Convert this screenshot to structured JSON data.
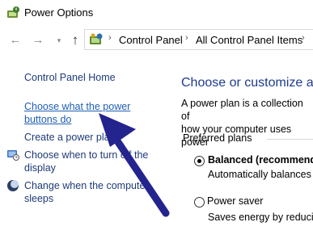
{
  "window": {
    "title": "Power Options",
    "app_icon": "power-options-icon"
  },
  "nav": {
    "back_icon": "back-arrow-icon",
    "forward_icon": "forward-arrow-icon",
    "recent_icon": "chevron-down-icon",
    "up_icon": "up-arrow-icon",
    "back_glyph": "←",
    "forward_glyph": "→",
    "recent_glyph": "▾",
    "up_glyph": "↑",
    "separator_glyph": "›"
  },
  "address": {
    "icon": "control-panel-icon",
    "crumbs": [
      "Control Panel",
      "All Control Panel Items"
    ]
  },
  "sidebar": {
    "home": "Control Panel Home",
    "items": [
      {
        "label": "Choose what the power\nbuttons do"
      },
      {
        "label": "Create a power plan"
      },
      {
        "label": "Choose when to turn off the\ndisplay",
        "icon": "display-icon"
      },
      {
        "label": "Change when the computer\nsleeps",
        "icon": "sleep-moon-icon"
      }
    ]
  },
  "main": {
    "heading": "Choose or customize a p",
    "description": "A power plan is a collection of\nhow your computer uses power",
    "preferred_plans_label": "Preferred plans",
    "plans": [
      {
        "name": "Balanced (recommende",
        "description": "Automatically balances p",
        "selected": true
      },
      {
        "name": "Power saver",
        "description": "Saves energy by reducing",
        "selected": false
      }
    ]
  },
  "annotation": {
    "arrow_color": "#24248f"
  }
}
